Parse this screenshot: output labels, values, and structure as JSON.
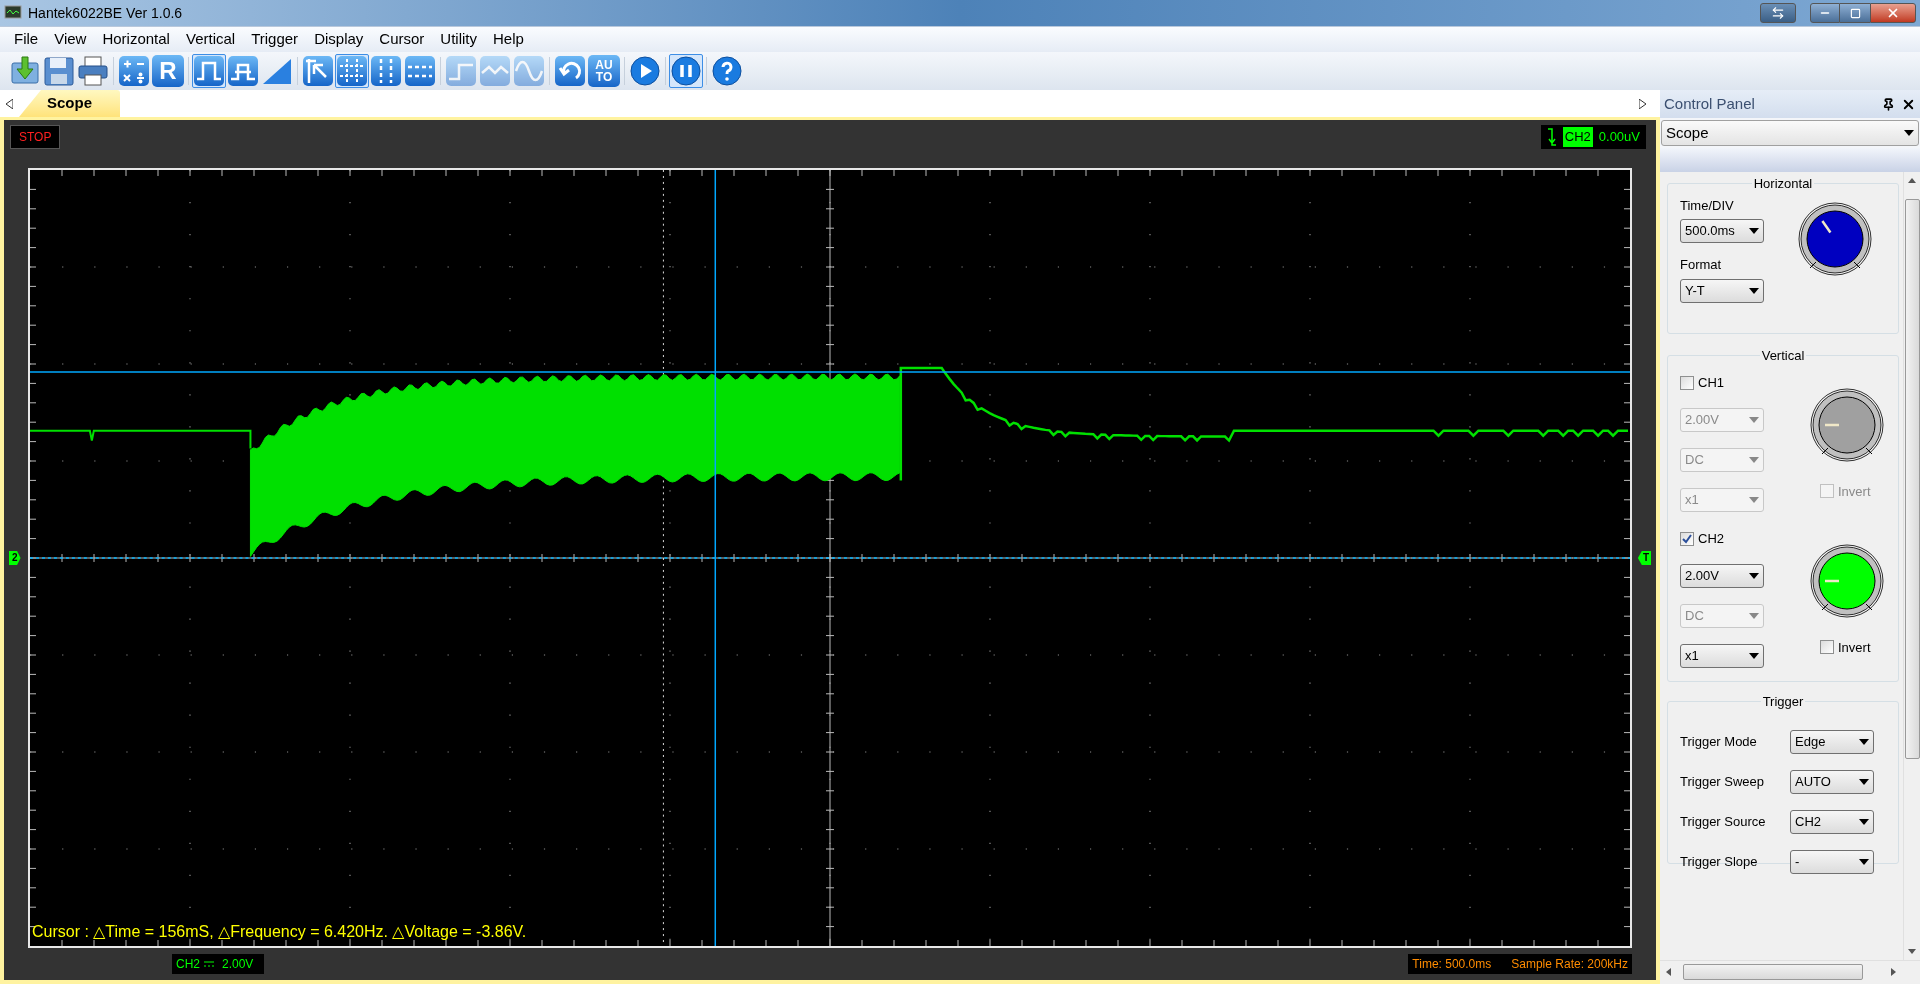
{
  "window": {
    "title": "Hantek6022BE Ver 1.0.6"
  },
  "menu": [
    "File",
    "View",
    "Horizontal",
    "Vertical",
    "Trigger",
    "Display",
    "Cursor",
    "Utility",
    "Help"
  ],
  "toolbar": [
    {
      "kind": "icon",
      "selected": false,
      "disabled": false
    },
    {
      "kind": "icon",
      "selected": false,
      "disabled": false
    },
    {
      "kind": "icon",
      "selected": false,
      "disabled": false
    },
    {
      "kind": "separator"
    },
    {
      "kind": "icon",
      "selected": false,
      "disabled": false
    },
    {
      "kind": "text",
      "label": "R",
      "selected": false,
      "disabled": false
    },
    {
      "kind": "separator"
    },
    {
      "kind": "icon",
      "selected": true,
      "disabled": false
    },
    {
      "kind": "icon",
      "selected": false,
      "disabled": false
    },
    {
      "kind": "icon",
      "selected": false,
      "disabled": false
    },
    {
      "kind": "separator"
    },
    {
      "kind": "icon",
      "selected": false,
      "disabled": false
    },
    {
      "kind": "icon",
      "selected": true,
      "disabled": false
    },
    {
      "kind": "icon",
      "selected": false,
      "disabled": false
    },
    {
      "kind": "icon",
      "selected": false,
      "disabled": false
    },
    {
      "kind": "separator"
    },
    {
      "kind": "icon",
      "selected": false,
      "disabled": true
    },
    {
      "kind": "icon",
      "selected": false,
      "disabled": true
    },
    {
      "kind": "icon",
      "selected": false,
      "disabled": true
    },
    {
      "kind": "separator"
    },
    {
      "kind": "icon",
      "selected": false,
      "disabled": false
    },
    {
      "kind": "text",
      "label": "AU TO",
      "selected": false,
      "disabled": false
    },
    {
      "kind": "separator"
    },
    {
      "kind": "icon",
      "selected": false,
      "disabled": false
    },
    {
      "kind": "separator"
    },
    {
      "kind": "icon",
      "selected": true,
      "disabled": false
    },
    {
      "kind": "separator"
    },
    {
      "kind": "icon",
      "selected": false,
      "disabled": false
    }
  ],
  "tabs": [
    {
      "label": "Scope",
      "selected": true
    }
  ],
  "scope": {
    "run_state": "STOP",
    "trigger_status": {
      "channel": "CH2",
      "value": "0.00uV"
    },
    "left_marker": "2",
    "right_marker": "T",
    "cursor_readout": "Cursor : △Time = 156mS, △Frequency = 6.420Hz. △Voltage = -3.86V.",
    "channel_info": {
      "channel": "CH2",
      "scale": "2.00V"
    },
    "time_info": "Time: 500.0ms",
    "sample_rate": "Sample Rate: 200kHz"
  },
  "control_panel": {
    "title": "Control Panel",
    "mode": "Scope",
    "horizontal": {
      "title": "Horizontal",
      "time_div_label": "Time/DIV",
      "time_div": "500.0ms",
      "format_label": "Format",
      "format": "Y-T",
      "knob": {
        "color": "#0000c0"
      }
    },
    "vertical": {
      "title": "Vertical",
      "channels": [
        {
          "label": "CH1",
          "checked": false,
          "scale": "2.00V",
          "scale_disabled": true,
          "coupling": "DC",
          "coupling_disabled": true,
          "probe": "x1",
          "probe_disabled": true,
          "invert_label": "Invert",
          "invert": false,
          "invert_disabled": true,
          "color": "#a0a0a0"
        },
        {
          "label": "CH2",
          "checked": true,
          "scale": "2.00V",
          "scale_disabled": false,
          "coupling": "DC",
          "coupling_disabled": true,
          "probe": "x1",
          "probe_disabled": false,
          "invert_label": "Invert",
          "invert": false,
          "invert_disabled": false,
          "color": "#00ff00"
        }
      ]
    },
    "trigger": {
      "title": "Trigger",
      "rows": [
        {
          "label": "Trigger Mode",
          "value": "Edge"
        },
        {
          "label": "Trigger Sweep",
          "value": "AUTO"
        },
        {
          "label": "Trigger Source",
          "value": "CH2"
        },
        {
          "label": "Trigger Slope",
          "value": "-"
        }
      ]
    }
  }
}
